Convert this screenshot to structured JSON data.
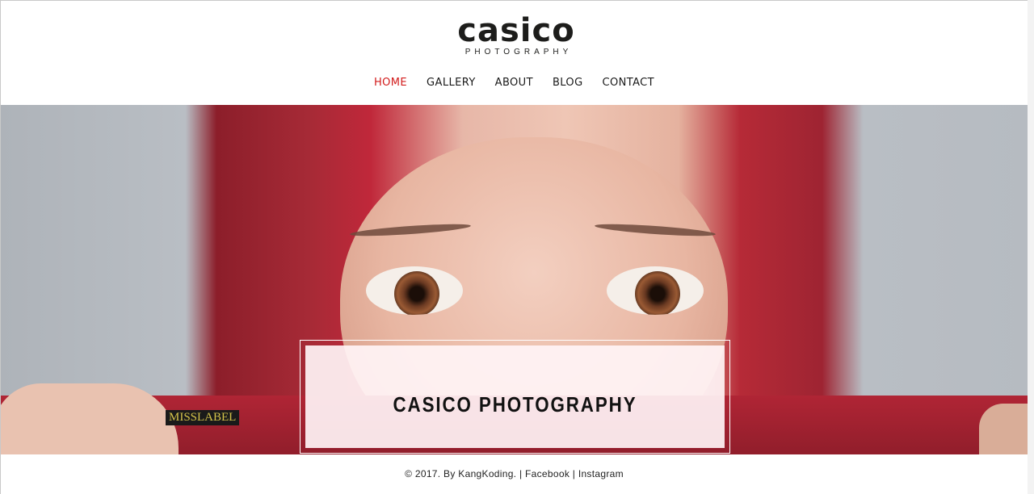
{
  "brand": {
    "logo_word": "casico",
    "logo_sub": "PHOTOGRAPHY"
  },
  "nav": {
    "items": [
      {
        "label": "HOME",
        "active": true
      },
      {
        "label": "GALLERY",
        "active": false
      },
      {
        "label": "ABOUT",
        "active": false
      },
      {
        "label": "BLOG",
        "active": false
      },
      {
        "label": "CONTACT",
        "active": false
      }
    ]
  },
  "hero": {
    "caption": "CASICO PHOTOGRAPHY",
    "veil_label": "MISSLABEL"
  },
  "footer": {
    "copyright": "© 2017. By KangKoding.",
    "sep": "|",
    "facebook": "Facebook",
    "instagram": "Instagram"
  },
  "colors": {
    "accent": "#d21b1b",
    "text": "#1a1a1a",
    "veil": "#a62a36"
  }
}
